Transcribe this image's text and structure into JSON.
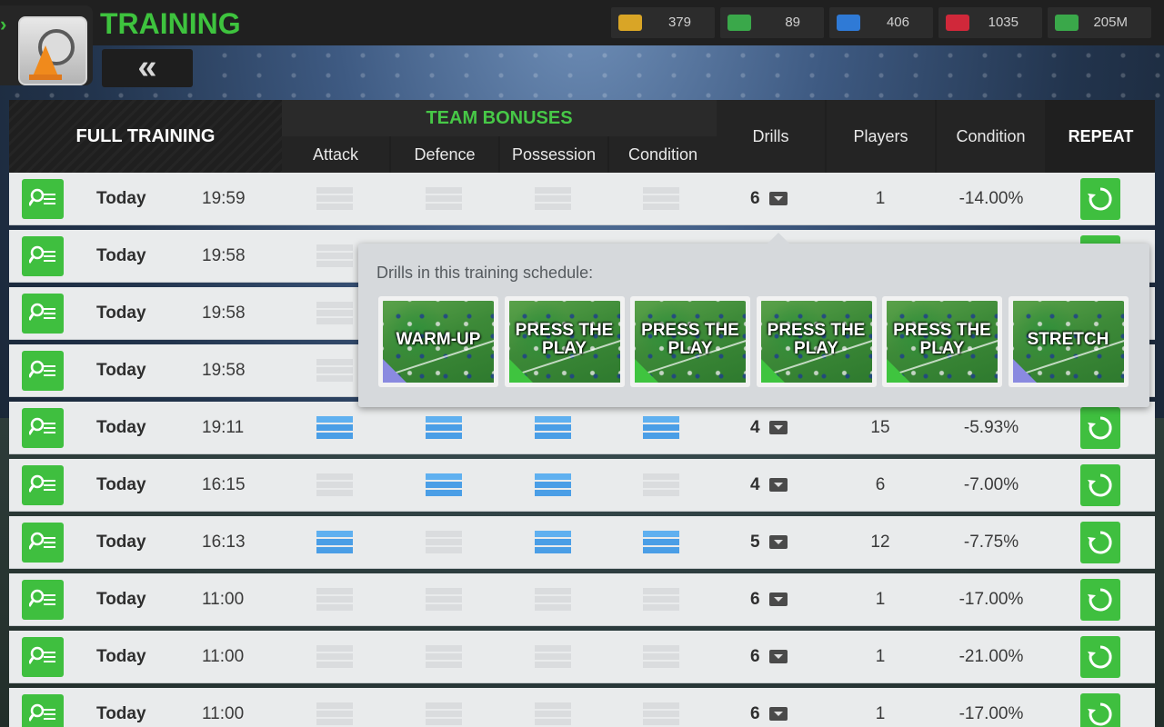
{
  "header": {
    "title": "TRAINING",
    "back_label": "«"
  },
  "currencies": [
    {
      "icon": "token-icon",
      "value": "379",
      "color": "#d9a526"
    },
    {
      "icon": "cash-icon",
      "value": "89",
      "color": "#3aa84a"
    },
    {
      "icon": "energy-icon",
      "value": "406",
      "color": "#2f7ad6"
    },
    {
      "icon": "medical-icon",
      "value": "1035",
      "color": "#d0283a"
    },
    {
      "icon": "money-icon",
      "value": "205M",
      "color": "#3aa84a"
    }
  ],
  "table": {
    "heading": "FULL TRAINING",
    "bonus_heading": "TEAM BONUSES",
    "bonus_columns": [
      "Attack",
      "Defence",
      "Possession",
      "Condition"
    ],
    "columns": {
      "drills": "Drills",
      "players": "Players",
      "condition": "Condition",
      "repeat": "REPEAT"
    },
    "rows": [
      {
        "day": "Today",
        "time": "19:59",
        "bonuses": [
          0,
          0,
          0,
          0
        ],
        "drills": "6",
        "players": "1",
        "condition": "-14.00%"
      },
      {
        "day": "Today",
        "time": "19:58",
        "bonuses": [
          0,
          0,
          0,
          0
        ],
        "drills": "",
        "players": "",
        "condition": ""
      },
      {
        "day": "Today",
        "time": "19:58",
        "bonuses": [
          0,
          0,
          0,
          0
        ],
        "drills": "",
        "players": "",
        "condition": ""
      },
      {
        "day": "Today",
        "time": "19:58",
        "bonuses": [
          0,
          0,
          0,
          0
        ],
        "drills": "",
        "players": "",
        "condition": ""
      },
      {
        "day": "Today",
        "time": "19:11",
        "bonuses": [
          1,
          1,
          1,
          1
        ],
        "drills": "4",
        "players": "15",
        "condition": "-5.93%"
      },
      {
        "day": "Today",
        "time": "16:15",
        "bonuses": [
          0,
          1,
          1,
          0
        ],
        "drills": "4",
        "players": "6",
        "condition": "-7.00%"
      },
      {
        "day": "Today",
        "time": "16:13",
        "bonuses": [
          1,
          0,
          1,
          1
        ],
        "drills": "5",
        "players": "12",
        "condition": "-7.75%"
      },
      {
        "day": "Today",
        "time": "11:00",
        "bonuses": [
          0,
          0,
          0,
          0
        ],
        "drills": "6",
        "players": "1",
        "condition": "-17.00%"
      },
      {
        "day": "Today",
        "time": "11:00",
        "bonuses": [
          0,
          0,
          0,
          0
        ],
        "drills": "6",
        "players": "1",
        "condition": "-21.00%"
      },
      {
        "day": "Today",
        "time": "11:00",
        "bonuses": [
          0,
          0,
          0,
          0
        ],
        "drills": "6",
        "players": "1",
        "condition": "-17.00%"
      }
    ]
  },
  "popup": {
    "title": "Drills in this training schedule:",
    "drills": [
      {
        "label": "WARM-UP",
        "corner": "blue"
      },
      {
        "label": "PRESS THE PLAY",
        "corner": "green"
      },
      {
        "label": "PRESS THE PLAY",
        "corner": "green"
      },
      {
        "label": "PRESS THE PLAY",
        "corner": "green"
      },
      {
        "label": "PRESS THE PLAY",
        "corner": "green"
      },
      {
        "label": "STRETCH",
        "corner": "blue"
      }
    ]
  }
}
